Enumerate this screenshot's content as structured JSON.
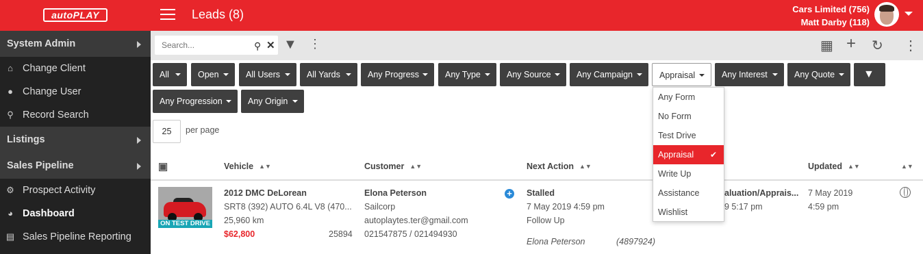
{
  "header": {
    "logo": "autoPLAY",
    "title": "Leads (8)",
    "client": "Cars Limited (756)",
    "user": "Matt Darby (118)"
  },
  "sidebar": {
    "sections": [
      {
        "label": "System Admin"
      },
      {
        "label": "Listings"
      },
      {
        "label": "Sales Pipeline"
      }
    ],
    "admin_items": [
      {
        "label": "Change Client",
        "icon": "home-icon"
      },
      {
        "label": "Change User",
        "icon": "user-icon"
      },
      {
        "label": "Record Search",
        "icon": "search-icon"
      }
    ],
    "pipeline_items": [
      {
        "label": "Prospect Activity",
        "icon": "gear-icon"
      },
      {
        "label": "Dashboard",
        "icon": "dashboard-icon"
      },
      {
        "label": "Sales Pipeline Reporting",
        "icon": "chart-icon"
      }
    ]
  },
  "toolbar": {
    "search_placeholder": "Search..."
  },
  "filters": {
    "row1": [
      "All",
      "Open",
      "All Users",
      "All Yards",
      "Any Progress",
      "Any Type",
      "Any Source",
      "Any Campaign",
      "Appraisal",
      "Any Interest",
      "Any Quote"
    ],
    "row2": [
      "Any Progression",
      "Any Origin"
    ]
  },
  "pagination": {
    "per_page_value": "25",
    "per_page_label": "per page"
  },
  "table": {
    "columns": {
      "vehicle": "Vehicle",
      "customer": "Customer",
      "next_action": "Next Action",
      "updated": "Updated"
    },
    "row": {
      "tag": "ON TEST DRIVE",
      "vehicle_title": "2012 DMC DeLorean",
      "vehicle_spec": "SRT8 (392) AUTO 6.4L V8 (470...",
      "odometer": "25,960 km",
      "price": "$62,800",
      "stock_no": "25894",
      "customer_name": "Elona Peterson",
      "company": "Sailcorp",
      "email": "autoplaytes.ter@gmail.com",
      "phone": "021547875 / 021494930",
      "status": "Stalled",
      "action_date": "7 May 2019 4:59 pm",
      "action_type": "Follow Up",
      "assigned_name": "Elona Peterson",
      "assigned_id": "(4897924)",
      "activity_partial": "aluation/Apprais...",
      "activity_time_partial": "9 5:17 pm",
      "updated_date": "7 May 2019",
      "updated_time": "4:59 pm"
    }
  },
  "form_dropdown": {
    "options": [
      "Any Form",
      "No Form",
      "Test Drive",
      "Appraisal",
      "Write Up",
      "Assistance",
      "Wishlist"
    ],
    "selected": "Appraisal"
  },
  "colors": {
    "brand": "#e8262b",
    "sidebar": "#222222",
    "filter_button": "#3f3f3f"
  }
}
